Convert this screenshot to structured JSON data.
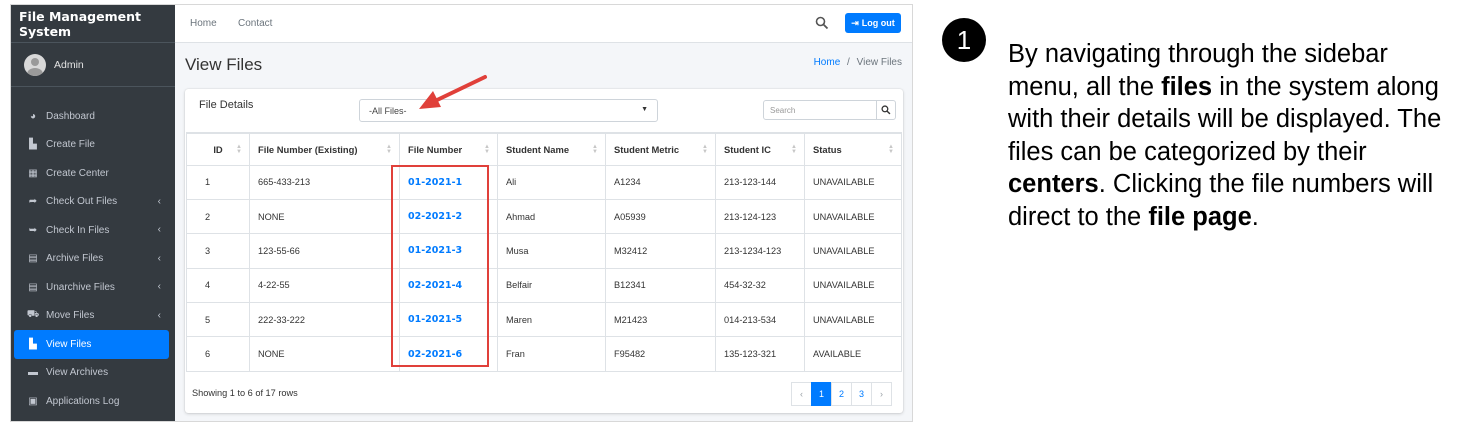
{
  "app": {
    "brand": "File Management System"
  },
  "user": {
    "name": "Admin"
  },
  "sidebar": {
    "items": [
      {
        "label": "Dashboard",
        "icon": "tachometer-icon",
        "glyph": "◕",
        "expand": false,
        "active": false
      },
      {
        "label": "Create File",
        "icon": "file-icon",
        "glyph": "▙",
        "expand": false,
        "active": false
      },
      {
        "label": "Create Center",
        "icon": "building-icon",
        "glyph": "▦",
        "expand": false,
        "active": false
      },
      {
        "label": "Check Out Files",
        "icon": "file-export-icon",
        "glyph": "➦",
        "expand": true,
        "active": false
      },
      {
        "label": "Check In Files",
        "icon": "file-import-icon",
        "glyph": "➥",
        "expand": true,
        "active": false
      },
      {
        "label": "Archive Files",
        "icon": "file-archive-icon",
        "glyph": "▤",
        "expand": true,
        "active": false
      },
      {
        "label": "Unarchive Files",
        "icon": "file-unarchive-icon",
        "glyph": "▤",
        "expand": true,
        "active": false
      },
      {
        "label": "Move Files",
        "icon": "dolly-icon",
        "glyph": "⛟",
        "expand": true,
        "active": false
      },
      {
        "label": "View Files",
        "icon": "file-icon",
        "glyph": "▙",
        "expand": false,
        "active": true
      },
      {
        "label": "View Archives",
        "icon": "archive-icon",
        "glyph": "▬",
        "expand": false,
        "active": false
      },
      {
        "label": "Applications Log",
        "icon": "clipboard-icon",
        "glyph": "▣",
        "expand": false,
        "active": false
      }
    ],
    "expand_glyph": "‹"
  },
  "topnav": {
    "home": "Home",
    "contact": "Contact",
    "logout": "Log out"
  },
  "page": {
    "title": "View Files",
    "breadcrumb_home": "Home",
    "breadcrumb_sep": "/",
    "breadcrumb_current": "View Files"
  },
  "card": {
    "title": "File Details",
    "filter_value": "-All Files-",
    "search_placeholder": "Search"
  },
  "table": {
    "columns": [
      "ID",
      "File Number (Existing)",
      "File Number",
      "Student Name",
      "Student Metric",
      "Student IC",
      "Status"
    ],
    "rows": [
      [
        "1",
        "665-433-213",
        "01-2021-1",
        "Ali",
        "A1234",
        "213-123-144",
        "UNAVAILABLE"
      ],
      [
        "2",
        "NONE",
        "02-2021-2",
        "Ahmad",
        "A05939",
        "213-124-123",
        "UNAVAILABLE"
      ],
      [
        "3",
        "123-55-66",
        "01-2021-3",
        "Musa",
        "M32412",
        "213-1234-123",
        "UNAVAILABLE"
      ],
      [
        "4",
        "4-22-55",
        "02-2021-4",
        "Belfair",
        "B12341",
        "454-32-32",
        "UNAVAILABLE"
      ],
      [
        "5",
        "222-33-222",
        "01-2021-5",
        "Maren",
        "M21423",
        "014-213-534",
        "UNAVAILABLE"
      ],
      [
        "6",
        "NONE",
        "02-2021-6",
        "Fran",
        "F95482",
        "135-123-321",
        "AVAILABLE"
      ]
    ]
  },
  "footer": {
    "summary": "Showing 1 to 6 of 17 rows"
  },
  "pager": {
    "prev": "‹",
    "pages": [
      "1",
      "2",
      "3"
    ],
    "next": "›",
    "current": "1"
  },
  "annotation": {
    "number": "1",
    "segments": [
      {
        "text": "By navigating through the sidebar menu, all the ",
        "bold": false
      },
      {
        "text": "files",
        "bold": true
      },
      {
        "text": " in the system along with their details will be displayed. The files can be categorized by their ",
        "bold": false
      },
      {
        "text": "centers",
        "bold": true
      },
      {
        "text": ". Clicking the file numbers will direct to the ",
        "bold": false
      },
      {
        "text": "file page",
        "bold": true
      },
      {
        "text": ".",
        "bold": false
      }
    ]
  },
  "colors": {
    "sidebar_bg": "#343a40",
    "accent": "#007bff",
    "highlight_red": "#e0403a"
  }
}
